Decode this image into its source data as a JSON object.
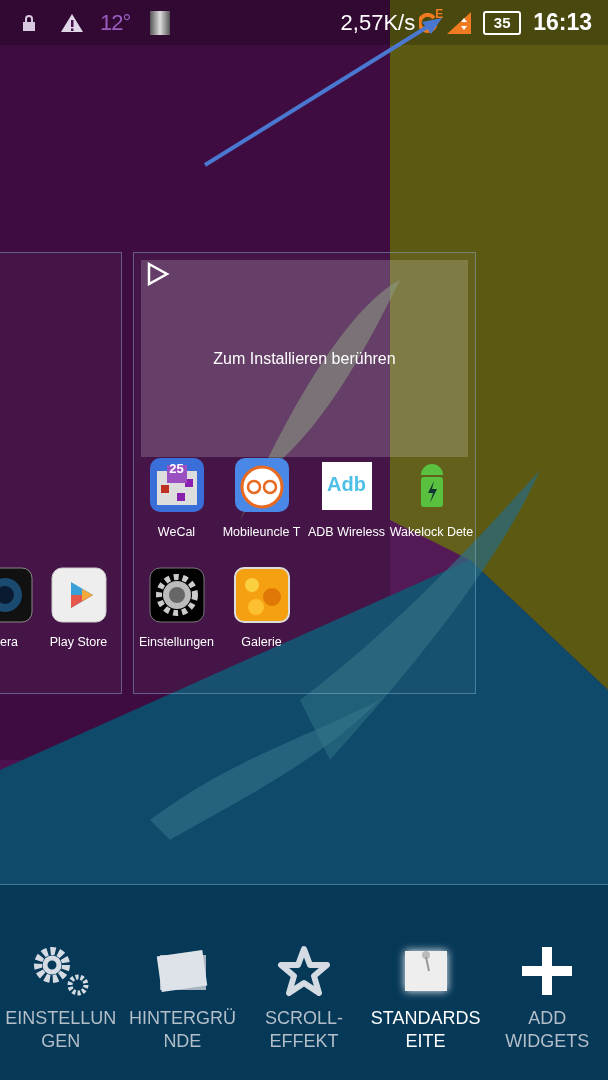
{
  "status_bar": {
    "temperature": "12°",
    "speed": "2,57K/s",
    "network_type": "E",
    "battery": "35",
    "time": "16:13"
  },
  "pages": [
    {
      "apps": [
        {
          "label": "era",
          "kind": "partial"
        },
        {
          "label": "Play Store",
          "kind": "app"
        }
      ]
    },
    {
      "widget": {
        "label": "Zum Installieren berühren"
      },
      "apps": [
        {
          "label": "WeCal",
          "kind": "app",
          "icon_text": "25"
        },
        {
          "label": "Mobileuncle T",
          "kind": "app"
        },
        {
          "label": "ADB Wireless",
          "kind": "app",
          "icon_text": "Adb"
        },
        {
          "label": "Wakelock Dete",
          "kind": "app"
        },
        {
          "label": "Einstellungen",
          "kind": "app"
        },
        {
          "label": "Galerie",
          "kind": "app"
        }
      ]
    }
  ],
  "toolbar": [
    {
      "label": "EINSTELLUN\nGEN",
      "selected": false
    },
    {
      "label": "HINTERGRÜ\nNDE",
      "selected": false
    },
    {
      "label": "SCROLL-\nEFFEKT",
      "selected": false
    },
    {
      "label": "STANDARDS\nEITE",
      "selected": true
    },
    {
      "label": "ADD\nWIDGETS",
      "selected": false
    }
  ]
}
